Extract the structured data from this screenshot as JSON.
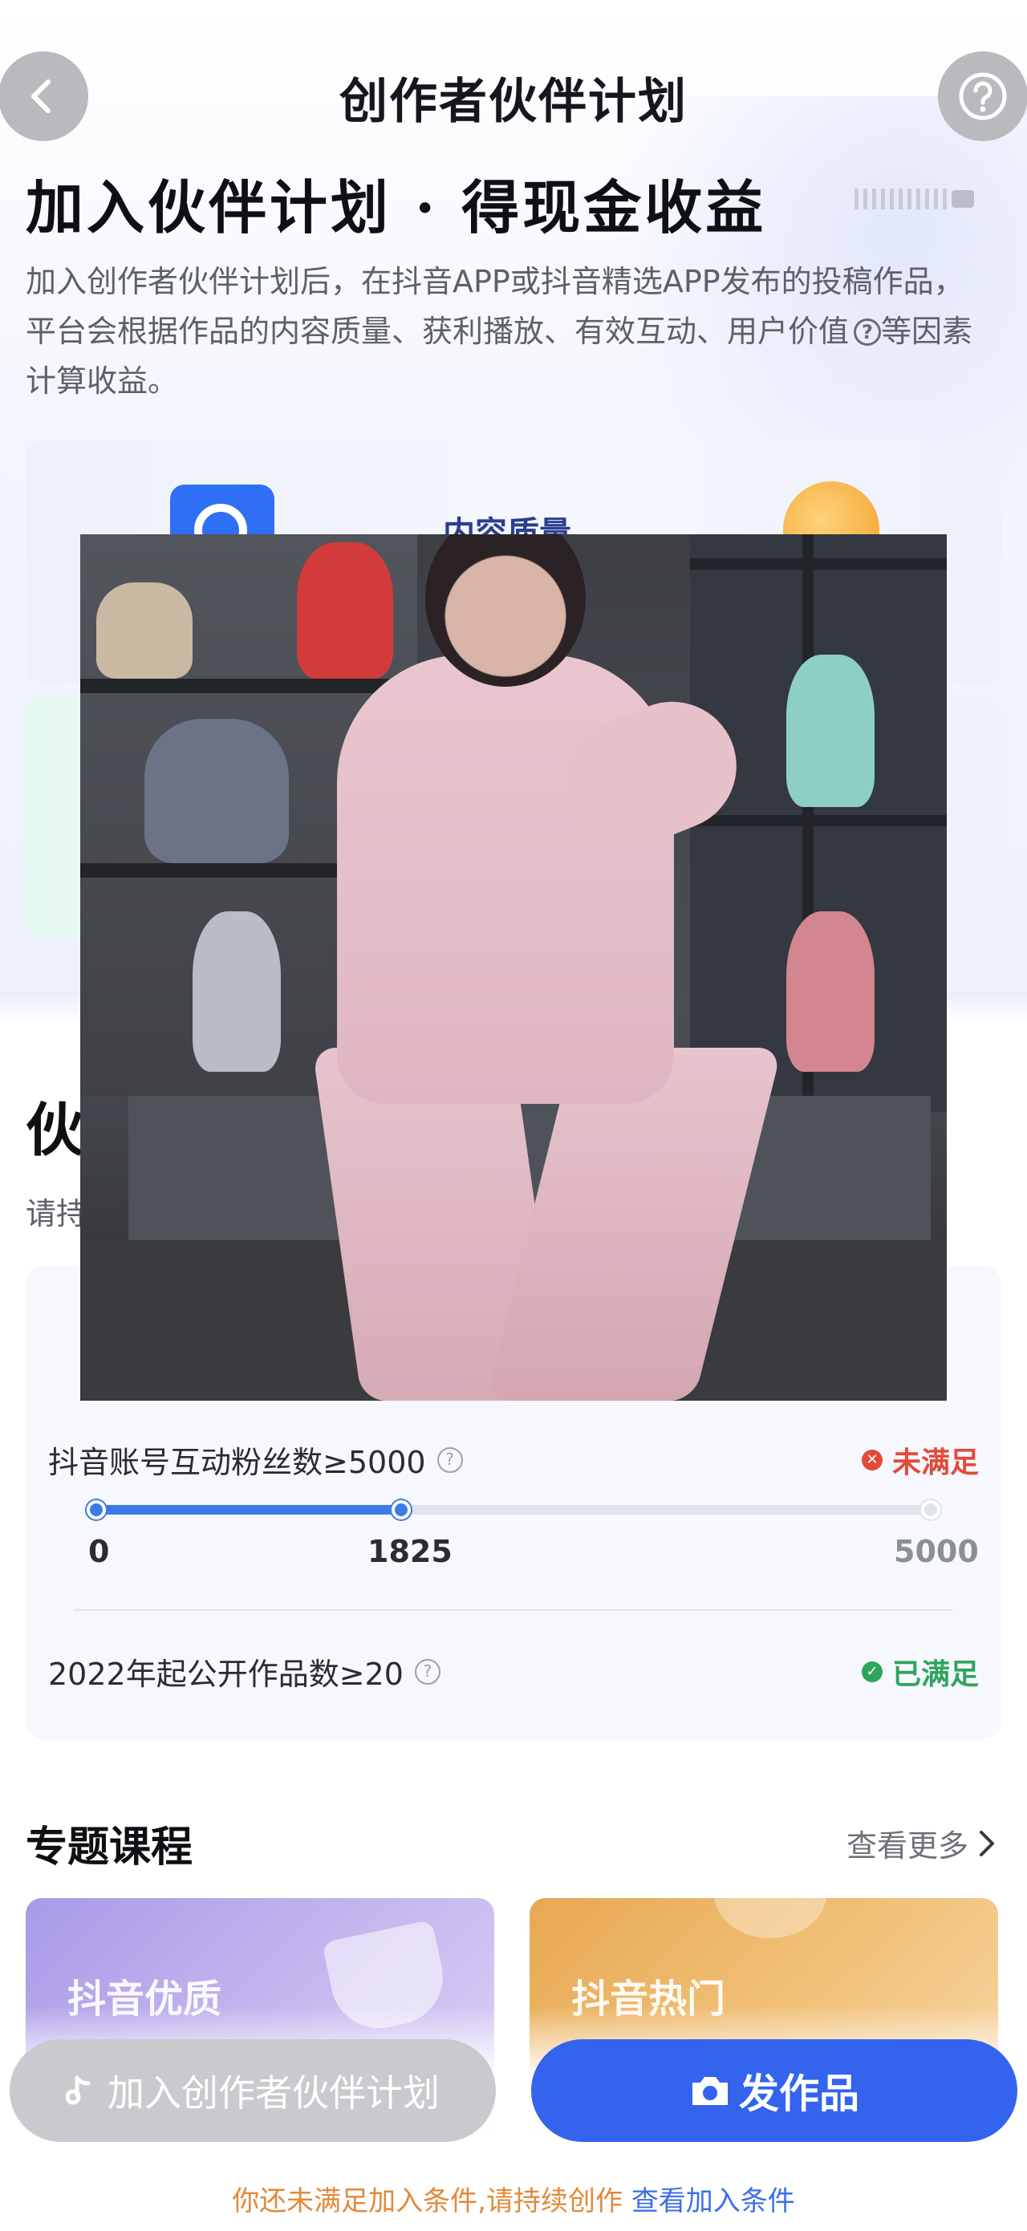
{
  "nav": {
    "title": "创作者伙伴计划",
    "back_icon": "chevron-left-icon",
    "help_icon": "question-circle-icon"
  },
  "hero": {
    "title": "加入伙伴计划 · 得现金收益",
    "description": "加入创作者伙伴计划后，在抖音APP或抖音精选APP发布的投稿作品，平台会根据作品的内容质量、获利播放、有效互动、用户价值",
    "description_tail": "等因素计算收益。",
    "feature_label": "内容质量"
  },
  "partner": {
    "title_visible": "伙",
    "sub_visible": "请持"
  },
  "requirements": [
    {
      "label": "抖音账号互动粉丝数≥5000",
      "status": "未满足",
      "status_type": "unmet",
      "progress": {
        "current": 1825,
        "target": 5000,
        "min": 0
      },
      "ticks": [
        "0",
        "1825",
        "5000"
      ]
    },
    {
      "label": "2022年起公开作品数≥20",
      "status": "已满足",
      "status_type": "met"
    }
  ],
  "courses": {
    "title": "专题课程",
    "more": "查看更多",
    "items": [
      {
        "label": "抖音优质"
      },
      {
        "label": "抖音热门"
      }
    ]
  },
  "bottom_bar": {
    "join_label": "加入创作者伙伴计划",
    "post_label": "发作品",
    "note": "你还未满足加入条件,请持续创作",
    "note_link": "查看加入条件"
  },
  "colors": {
    "primary": "#3463ee",
    "progress": "#3c7ae8",
    "unmet": "#e24a3b",
    "met": "#2ea55c",
    "disabled": "#c9cacd",
    "note": "#e08a3a"
  },
  "overlay": {
    "type": "video-frame",
    "subject": "person-dancing-in-pink-outfit"
  }
}
